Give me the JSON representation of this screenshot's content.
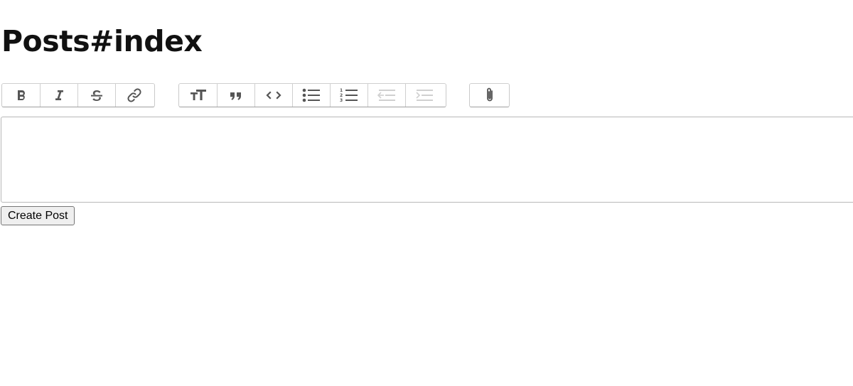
{
  "page": {
    "title": "Posts#index"
  },
  "toolbar": {
    "text_tools": [
      {
        "name": "bold",
        "icon": "bold-icon"
      },
      {
        "name": "italic",
        "icon": "italic-icon"
      },
      {
        "name": "strike",
        "icon": "strikethrough-icon"
      },
      {
        "name": "link",
        "icon": "link-icon"
      }
    ],
    "block_tools": [
      {
        "name": "heading",
        "icon": "heading-icon"
      },
      {
        "name": "quote",
        "icon": "quote-icon"
      },
      {
        "name": "code",
        "icon": "code-icon"
      },
      {
        "name": "bullet-list",
        "icon": "bullet-list-icon"
      },
      {
        "name": "number-list",
        "icon": "number-list-icon"
      },
      {
        "name": "decrease-nesting",
        "icon": "decrease-indent-icon",
        "disabled": true
      },
      {
        "name": "increase-nesting",
        "icon": "increase-indent-icon",
        "disabled": true
      }
    ],
    "file_tools": [
      {
        "name": "attach",
        "icon": "paperclip-icon"
      }
    ]
  },
  "editor": {
    "content": ""
  },
  "form": {
    "submit_label": "Create Post"
  },
  "colors": {
    "icon": "#555555",
    "icon_disabled": "#d0d0d0",
    "border": "#c9c9c9"
  }
}
